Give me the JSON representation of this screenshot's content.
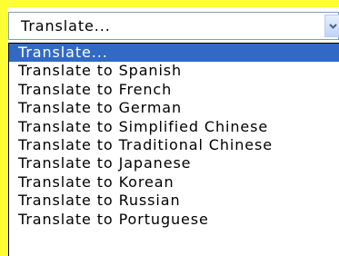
{
  "select": {
    "value": "Translate...",
    "arrow_icon": "chevron-down-icon"
  },
  "dropdown": {
    "options": [
      "Translate...",
      "Translate to Spanish",
      "Translate to French",
      "Translate to German",
      "Translate to Simplified Chinese",
      "Translate to Traditional Chinese",
      "Translate to Japanese",
      "Translate to Korean",
      "Translate to Russian",
      "Translate to Portuguese"
    ],
    "selected_index": 0
  },
  "colors": {
    "highlight": "#316ac5",
    "highlight_text": "#ffffff",
    "page_accent": "#ffff33",
    "select_border": "#7f9db9"
  }
}
